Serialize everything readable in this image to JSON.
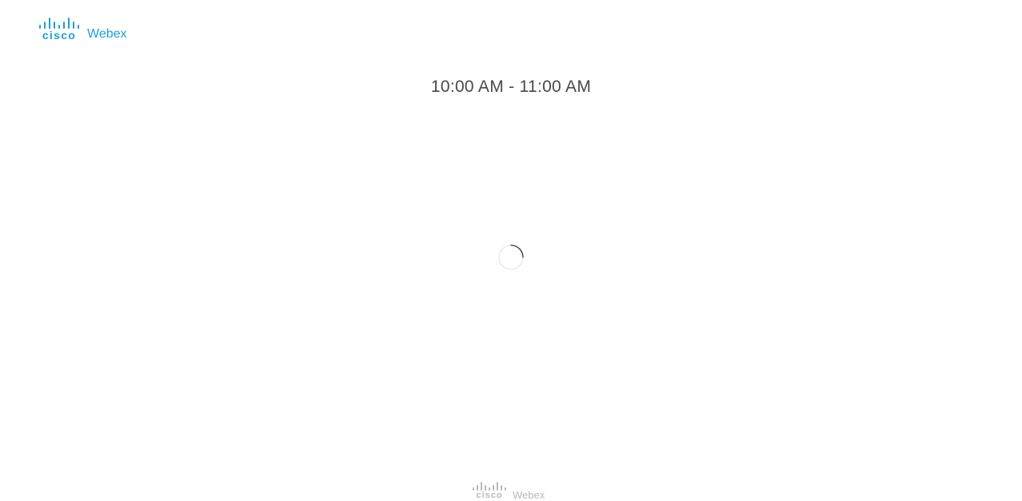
{
  "header": {
    "logo": {
      "brand": "cisco",
      "product": "Webex",
      "color": "#1ba0d7"
    }
  },
  "main": {
    "meeting_time": "10:00 AM - 11:00 AM",
    "loading_indicator": "spinner-icon"
  },
  "footer": {
    "logo": {
      "brand": "cisco",
      "product": "Webex",
      "color": "#b8b8b8"
    }
  }
}
